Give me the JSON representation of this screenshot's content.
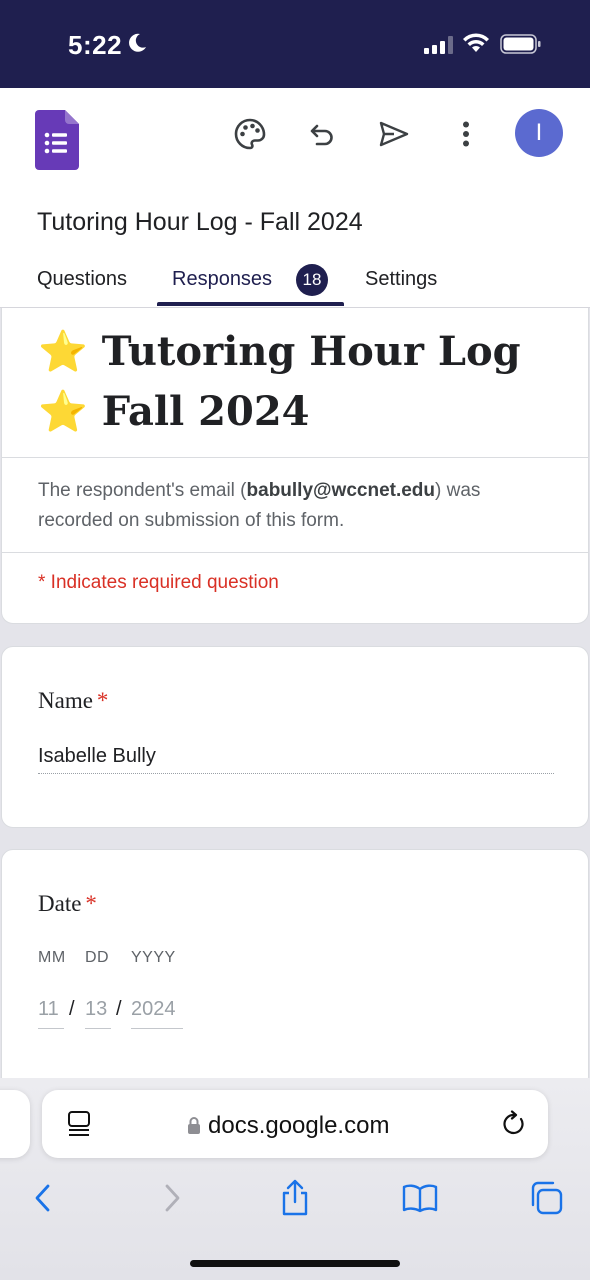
{
  "status_bar": {
    "time": "5:22"
  },
  "app": {
    "document_title": "Tutoring Hour Log - Fall 2024",
    "avatar_initial": "I",
    "tabs": [
      {
        "label": "Questions"
      },
      {
        "label": "Responses",
        "badge": "18",
        "active": true
      },
      {
        "label": "Settings"
      }
    ]
  },
  "form": {
    "title": "⭐ Tutoring Hour Log ⭐ Fall 2024",
    "email_note_prefix": "The respondent's email (",
    "email": "babully@wccnet.edu",
    "email_note_suffix": ") was recorded on submission of this form.",
    "required_note": "* Indicates required question",
    "questions": [
      {
        "label": "Name",
        "required_mark": "*",
        "answer": "Isabelle Bully"
      },
      {
        "label": "Date",
        "required_mark": "*",
        "parts": [
          {
            "label": "MM",
            "value": "11"
          },
          {
            "label": "DD",
            "value": "13"
          },
          {
            "label": "YYYY",
            "value": "2024"
          }
        ],
        "separator": "/"
      }
    ]
  },
  "browser": {
    "url": "docs.google.com"
  },
  "colors": {
    "header_bg": "#1f1f4f",
    "forms_purple": "#673ab7",
    "required_red": "#d93025",
    "avatar": "#5b6ad0"
  }
}
